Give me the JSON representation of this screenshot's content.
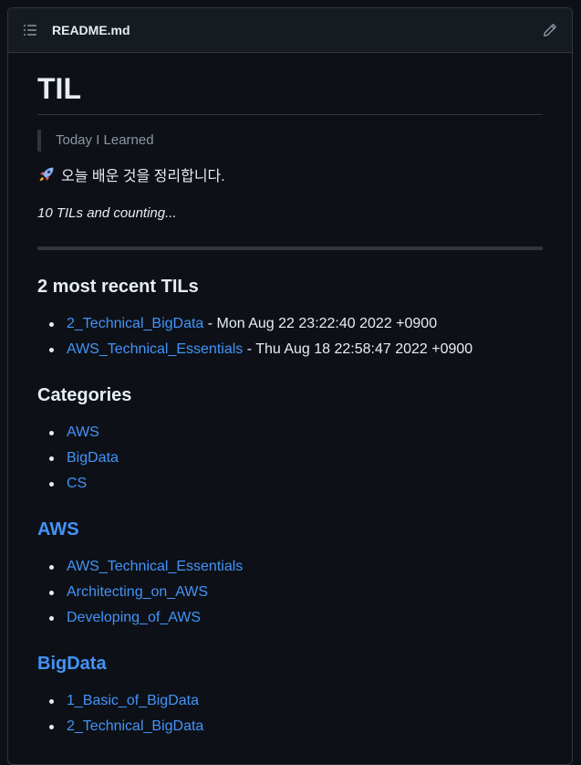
{
  "header": {
    "file_name": "README.md"
  },
  "readme": {
    "title": "TIL",
    "quote": "Today I Learned",
    "intro": "오늘 배운 것을 정리합니다.",
    "counting": "10 TILs and counting...",
    "recent": {
      "heading": "2 most recent TILs",
      "items": [
        {
          "link": "2_Technical_BigData",
          "date": " - Mon Aug 22 23:22:40 2022 +0900"
        },
        {
          "link": "AWS_Technical_Essentials",
          "date": " - Thu Aug 18 22:58:47 2022 +0900"
        }
      ]
    },
    "categories": {
      "heading": "Categories",
      "items": [
        "AWS",
        "BigData",
        "CS"
      ]
    },
    "aws": {
      "heading": "AWS",
      "items": [
        "AWS_Technical_Essentials",
        "Architecting_on_AWS",
        "Developing_of_AWS"
      ]
    },
    "bigdata": {
      "heading": "BigData",
      "items": [
        "1_Basic_of_BigData",
        "2_Technical_BigData"
      ]
    }
  },
  "icons": {
    "toc": "list-unordered-icon",
    "edit": "pencil-icon",
    "emoji": "rocket-emoji-icon"
  },
  "colors": {
    "background": "#0d1117",
    "header_bg": "#161b22",
    "border": "#30363d",
    "text": "#e6edf3",
    "muted": "#8d96a0",
    "link": "#4493f8"
  }
}
